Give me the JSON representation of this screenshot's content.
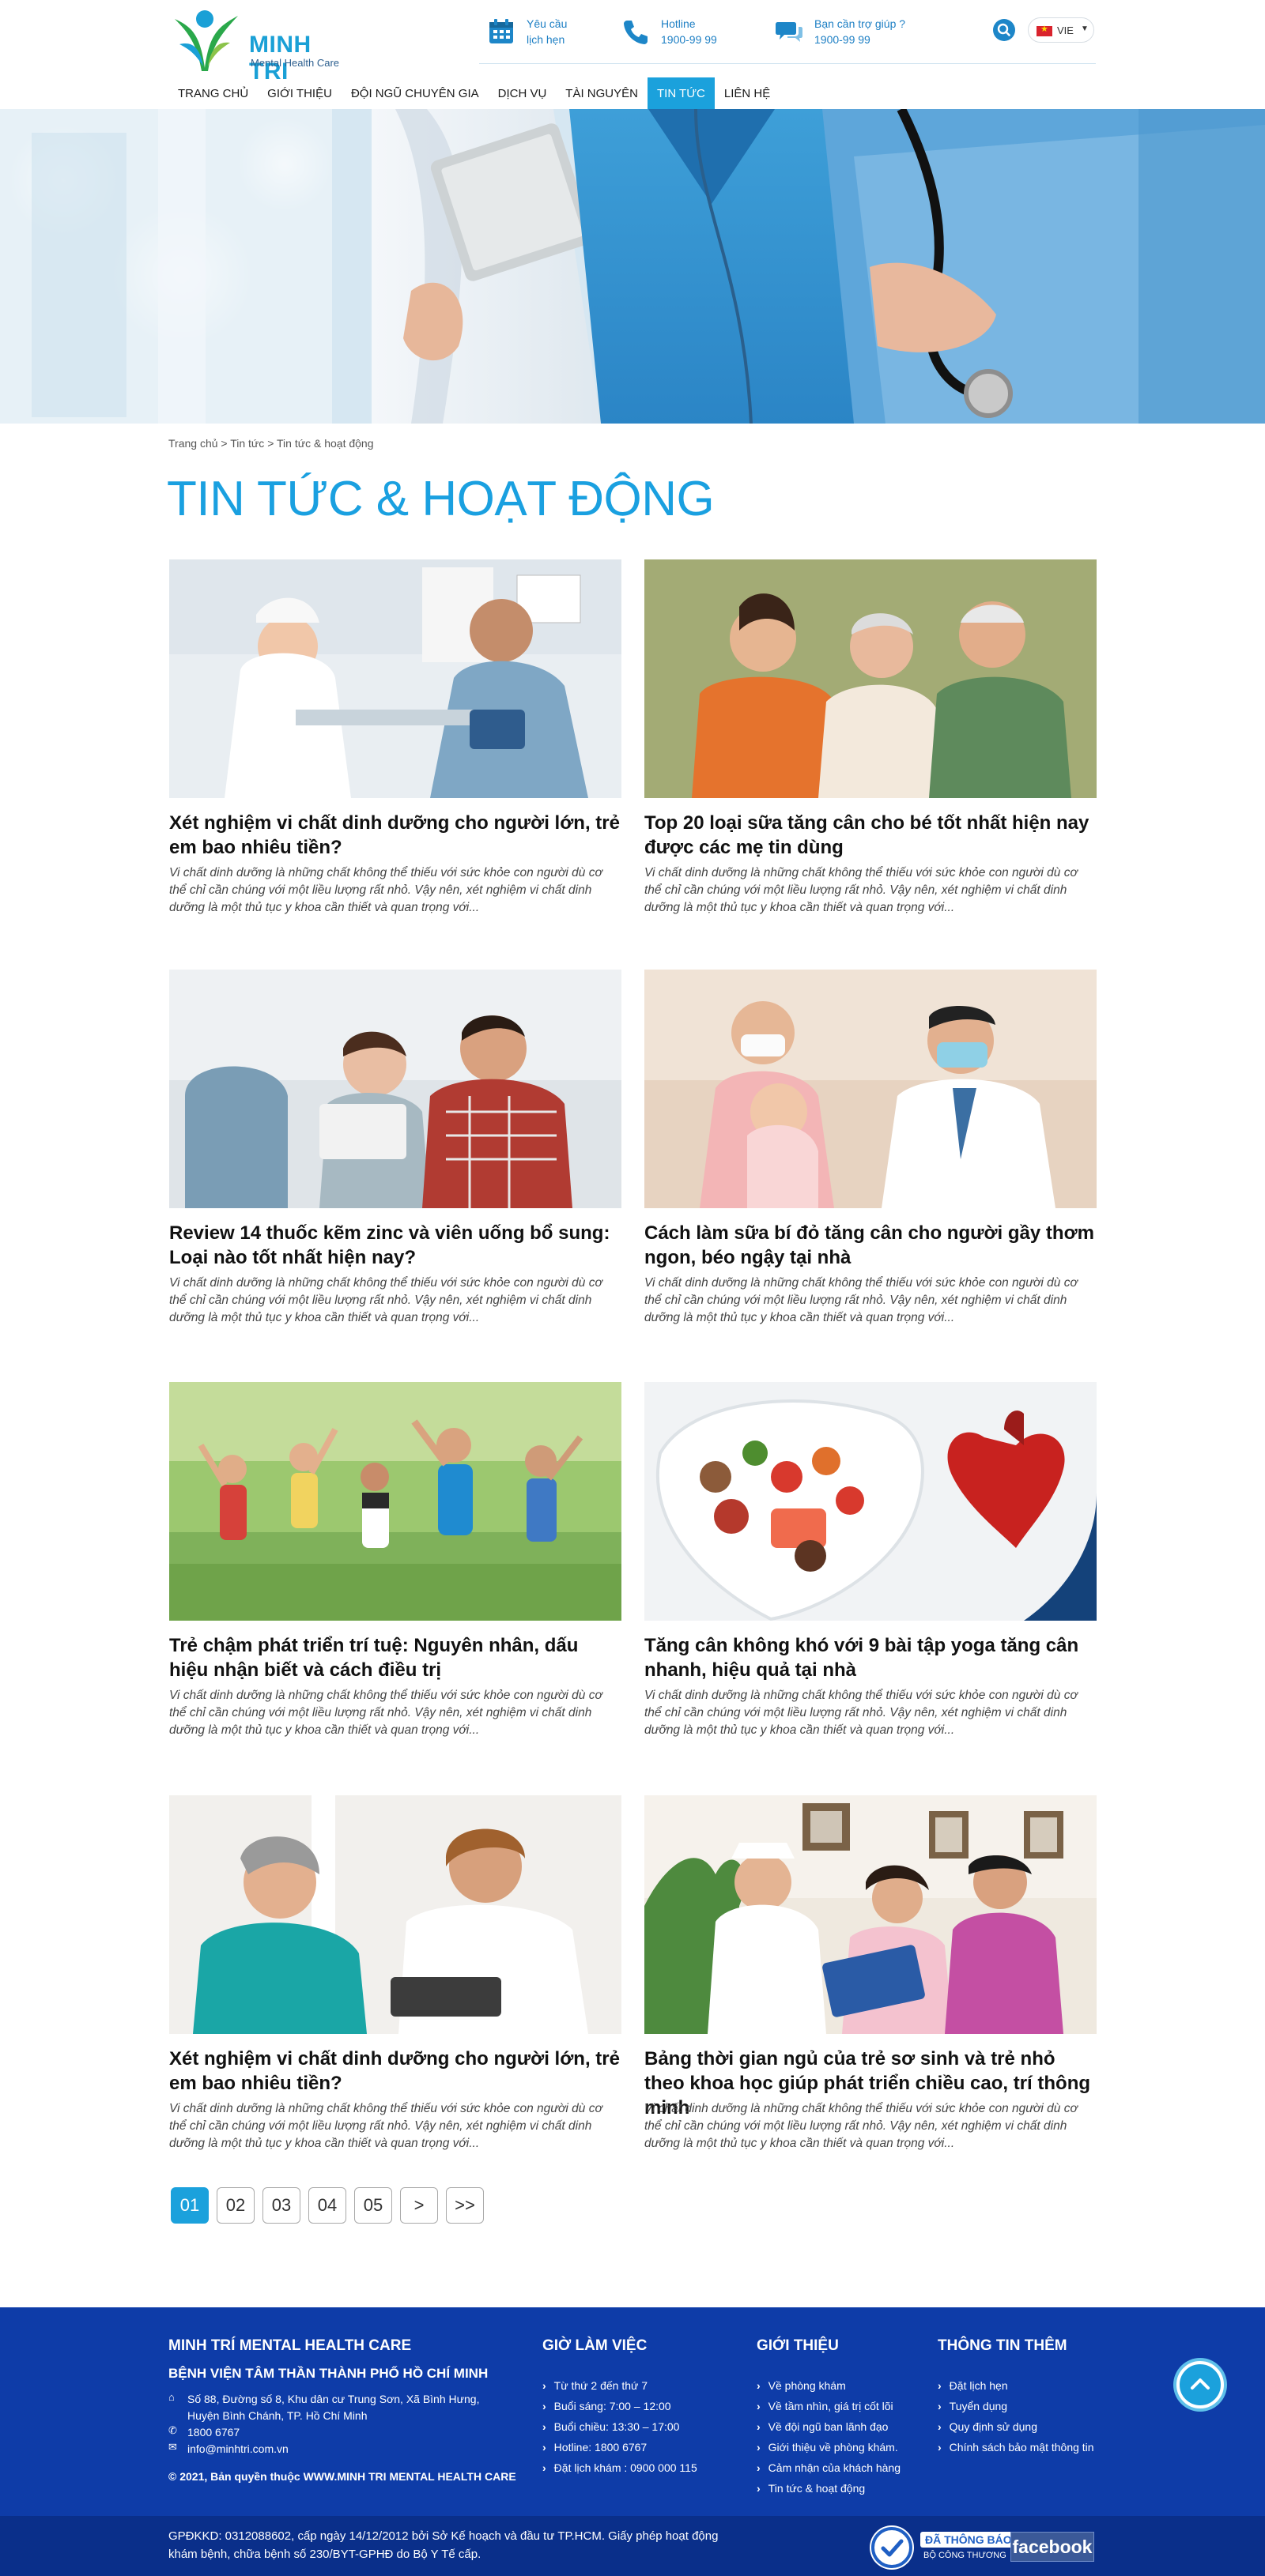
{
  "header": {
    "logo_name": "MINH TRI",
    "logo_sub": "Mental Health Care",
    "appointment_line1": "Yêu cầu",
    "appointment_line2": "lịch hẹn",
    "hotline_label": "Hotline",
    "hotline_number": "1900-99 99",
    "support_label": "Bạn cần trợ giúp ?",
    "support_number": "1900-99 99",
    "language": "VIE"
  },
  "nav": {
    "items": [
      "TRANG CHỦ",
      "GIỚI THIỆU",
      "ĐỘI NGŨ CHUYÊN GIA",
      "DỊCH VỤ",
      "TÀI NGUYÊN",
      "TIN TỨC",
      "LIÊN HỆ"
    ],
    "active_index": 5
  },
  "breadcrumb": {
    "home": "Trang chủ",
    "sep": " > ",
    "news": "Tin tức",
    "current": "Tin tức & hoạt động"
  },
  "page_title": "TIN TỨC & HOẠT ĐỘNG",
  "articles": [
    {
      "title": "Xét nghiệm vi chất dinh dưỡng cho người lớn, trẻ em bao nhiêu tiền?",
      "excerpt": "Vi chất dinh dưỡng là những chất không thể thiếu với sức khỏe con người dù cơ thể chỉ cần chúng với một liều lượng rất nhỏ. Vậy nên, xét nghiệm vi chất dinh dưỡng là một thủ tục y khoa cần thiết và quan trọng với..."
    },
    {
      "title": "Top 20 loại sữa tăng cân cho bé tốt nhất hiện nay được các mẹ tin dùng",
      "excerpt": "Vi chất dinh dưỡng là những chất không thể thiếu với sức khỏe con người dù cơ thể chỉ cần chúng với một liều lượng rất nhỏ. Vậy nên, xét nghiệm vi chất dinh dưỡng là một thủ tục y khoa cần thiết và quan trọng với..."
    },
    {
      "title": "Review 14 thuốc kẽm zinc và viên uống bổ sung: Loại nào tốt nhất hiện nay?",
      "excerpt": "Vi chất dinh dưỡng là những chất không thể thiếu với sức khỏe con người dù cơ thể chỉ cần chúng với một liều lượng rất nhỏ. Vậy nên, xét nghiệm vi chất dinh dưỡng là một thủ tục y khoa cần thiết và quan trọng với..."
    },
    {
      "title": "Cách làm sữa bí đỏ tăng cân cho người gầy thơm ngon, béo ngậy tại nhà",
      "excerpt": "Vi chất dinh dưỡng là những chất không thể thiếu với sức khỏe con người dù cơ thể chỉ cần chúng với một liều lượng rất nhỏ. Vậy nên, xét nghiệm vi chất dinh dưỡng là một thủ tục y khoa cần thiết và quan trọng với..."
    },
    {
      "title": "Trẻ chậm phát triển trí tuệ: Nguyên nhân, dấu hiệu nhận biết và cách điều trị",
      "excerpt": "Vi chất dinh dưỡng là những chất không thể thiếu với sức khỏe con người dù cơ thể chỉ cần chúng với một liều lượng rất nhỏ. Vậy nên, xét nghiệm vi chất dinh dưỡng là một thủ tục y khoa cần thiết và quan trọng với..."
    },
    {
      "title": "Tăng cân không khó với 9 bài tập yoga tăng cân nhanh, hiệu quả tại nhà",
      "excerpt": "Vi chất dinh dưỡng là những chất không thể thiếu với sức khỏe con người dù cơ thể chỉ cần chúng với một liều lượng rất nhỏ. Vậy nên, xét nghiệm vi chất dinh dưỡng là một thủ tục y khoa cần thiết và quan trọng với..."
    },
    {
      "title": "Xét nghiệm vi chất dinh dưỡng cho người lớn, trẻ em bao nhiêu tiền?",
      "excerpt": "Vi chất dinh dưỡng là những chất không thể thiếu với sức khỏe con người dù cơ thể chỉ cần chúng với một liều lượng rất nhỏ. Vậy nên, xét nghiệm vi chất dinh dưỡng là một thủ tục y khoa cần thiết và quan trọng với..."
    },
    {
      "title": "Bảng thời gian ngủ của trẻ sơ sinh và trẻ nhỏ theo khoa học giúp phát triển chiều cao, trí thông minh",
      "excerpt": "Vi chất dinh dưỡng là những chất không thể thiếu với sức khỏe con người dù cơ thể chỉ cần chúng với một liều lượng rất nhỏ. Vậy nên, xét nghiệm vi chất dinh dưỡng là một thủ tục y khoa cần thiết và quan trọng với..."
    }
  ],
  "pagination": {
    "pages": [
      "01",
      "02",
      "03",
      "04",
      "05"
    ],
    "next": ">",
    "last": ">>",
    "active_index": 0
  },
  "footer": {
    "org_title": "MINH TRÍ MENTAL HEALTH CARE",
    "org_sub": "BỆNH VIỆN TÂM THẦN THÀNH PHỐ HỒ CHÍ MINH",
    "address_line1": "Số 88, Đường số 8, Khu dân cư Trung Sơn, Xã Bình Hưng,",
    "address_line2": "Huyện Bình Chánh, TP. Hồ Chí Minh",
    "phone": "1800 6767",
    "email": "info@minhtri.com.vn",
    "copyright": "© 2021, Bản quyền thuộc WWW.MINH TRI MENTAL HEALTH CARE",
    "hours_title": "GIỜ LÀM VIỆC",
    "hours": [
      "Từ thứ 2 đến thứ 7",
      "Buổi sáng: 7:00 – 12:00",
      "Buổi chiều: 13:30 – 17:00",
      "Hotline: 1800 6767",
      "Đặt lịch khám : 0900 000 115"
    ],
    "intro_title": "GIỚI THIỆU",
    "intro_links": [
      "Về phòng khám",
      "Về tầm nhìn, giá trị cốt lõi",
      "Về đội ngũ ban lãnh đạo",
      "Giới thiệu về phòng khám.",
      "Cảm nhận của khách hàng",
      "Tin tức & hoạt động"
    ],
    "more_title": "THÔNG TIN THÊM",
    "more_links": [
      "Đặt lịch hẹn",
      "Tuyển dụng",
      "Quy định sử dụng",
      "Chính sách bảo mật thông tin"
    ],
    "license": "GPĐKKD: 0312088602, cấp ngày 14/12/2012 bởi Sở Kế hoạch và đầu tư TP.HCM. Giấy phép hoạt động khám bệnh, chữa bệnh số 230/BYT-GPHĐ do Bộ Y Tế cấp.",
    "bct_line1": "ĐÃ THÔNG BÁO",
    "bct_line2": "BỘ CÔNG THƯƠNG",
    "facebook": "facebook"
  },
  "colors": {
    "accent": "#1ba1dc",
    "brand_dark": "#0e3ca8",
    "title_blue": "#1aa0e0"
  }
}
